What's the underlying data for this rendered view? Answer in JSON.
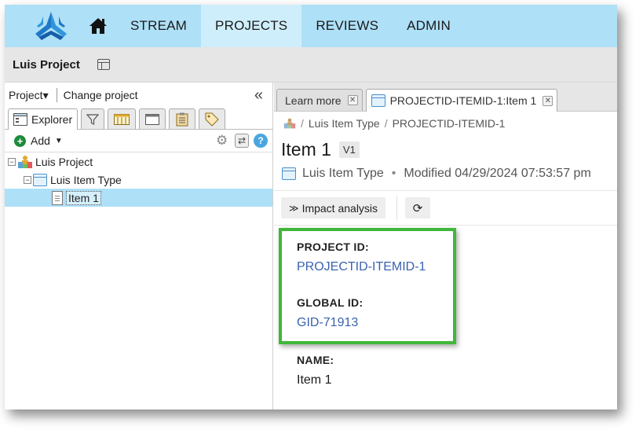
{
  "nav": {
    "items": [
      {
        "label": "STREAM",
        "active": false
      },
      {
        "label": "PROJECTS",
        "active": true
      },
      {
        "label": "REVIEWS",
        "active": false
      },
      {
        "label": "ADMIN",
        "active": false
      }
    ],
    "bg_color": "#aee0f7",
    "active_color": "#cfeefb"
  },
  "project_bar": {
    "title": "Luis Project"
  },
  "left_panel": {
    "project_menu": "Project▾",
    "change_project": "Change project",
    "collapse_icon": "«",
    "tabs": [
      {
        "label": "Explorer",
        "icon": "explorer-icon",
        "active": true
      },
      {
        "label": "",
        "icon": "filter-icon",
        "active": false
      },
      {
        "label": "",
        "icon": "grid-icon",
        "active": false
      },
      {
        "label": "",
        "icon": "window-icon",
        "active": false
      },
      {
        "label": "",
        "icon": "clipboard-icon",
        "active": false
      },
      {
        "label": "",
        "icon": "tag-icon",
        "active": false
      }
    ],
    "add_label": "Add",
    "tree": [
      {
        "label": "Luis Project",
        "level": 0
      },
      {
        "label": "Luis Item Type",
        "level": 1
      },
      {
        "label": "Item 1",
        "level": 2
      }
    ]
  },
  "right_panel": {
    "tabs": [
      {
        "label": "Learn more",
        "active": false
      },
      {
        "label": "PROJECTID-ITEMID-1:Item 1",
        "active": true
      }
    ],
    "breadcrumb": {
      "item_type": "Luis Item Type",
      "item_id": "PROJECTID-ITEMID-1"
    },
    "title": "Item 1",
    "version": "V1",
    "meta": {
      "item_type": "Luis Item Type",
      "modified": "Modified 04/29/2024 07:53:57 pm"
    },
    "impact_label": "Impact analysis",
    "fields": [
      {
        "label": "PROJECT ID:",
        "value": "PROJECTID-ITEMID-1",
        "link": true
      },
      {
        "label": "GLOBAL ID:",
        "value": "GID-71913",
        "link": true
      },
      {
        "label": "NAME:",
        "value": "Item 1",
        "link": false
      }
    ],
    "highlight_color": "#3fb73a",
    "link_color": "#3a62b0"
  }
}
